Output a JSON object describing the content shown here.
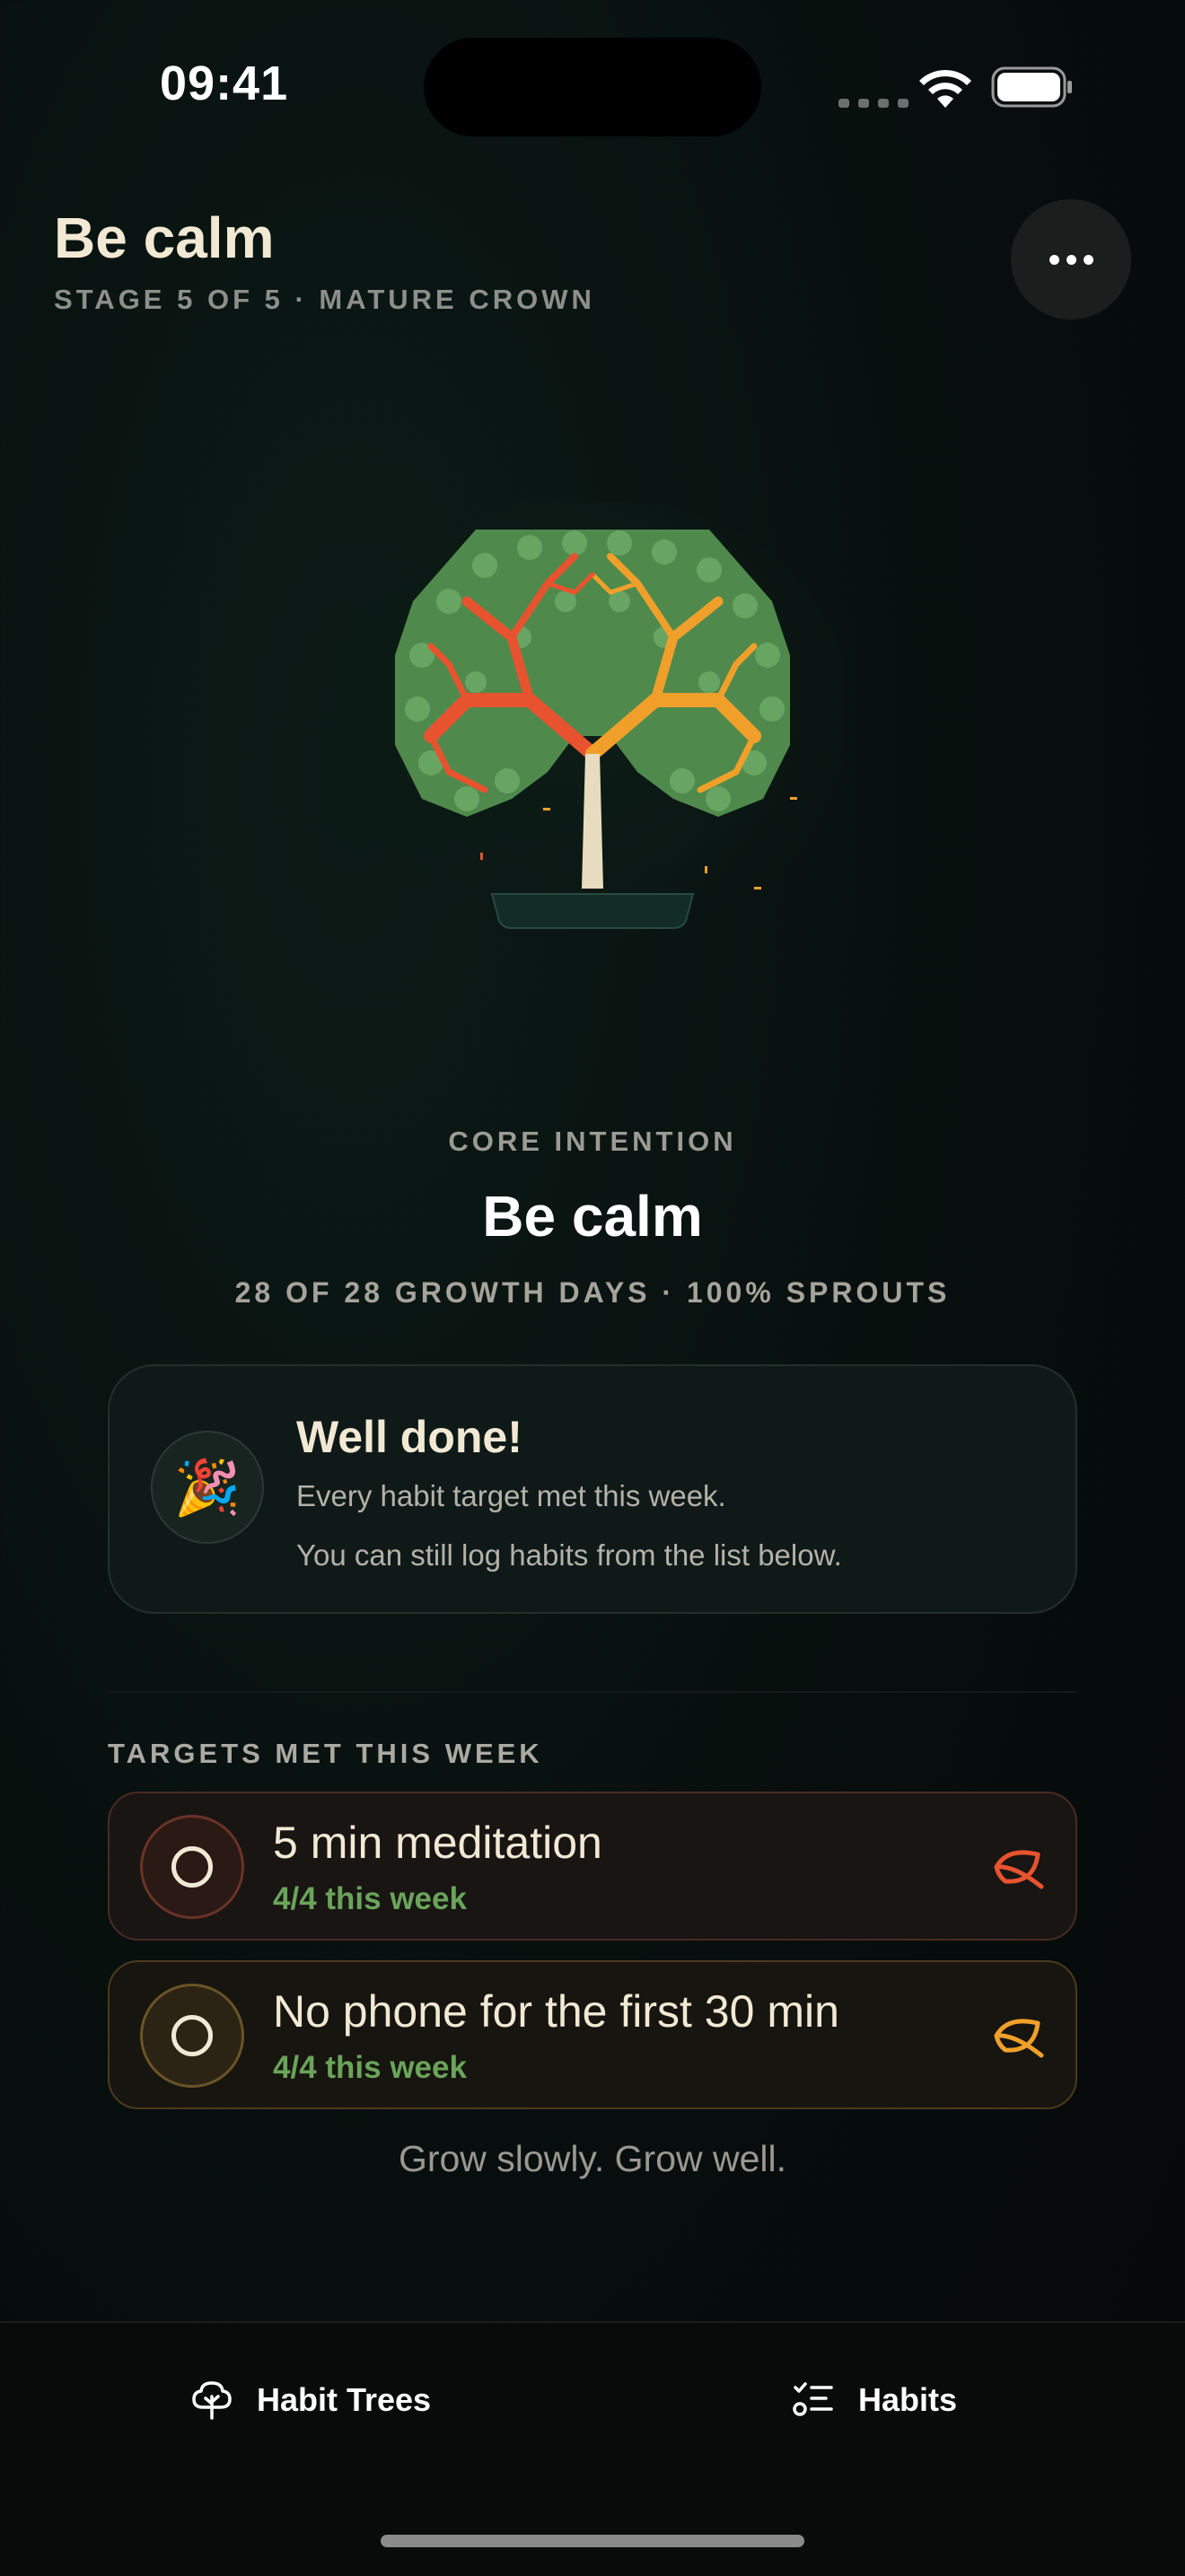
{
  "status_bar": {
    "time": "09:41"
  },
  "header": {
    "title": "Be calm",
    "subtitle": "STAGE 5 OF 5 · MATURE CROWN"
  },
  "core": {
    "label": "CORE INTENTION",
    "title": "Be calm",
    "stats": "28 OF 28 GROWTH DAYS · 100% SPROUTS"
  },
  "congrats": {
    "emoji": "🎉",
    "title": "Well done!",
    "line1": "Every habit target met this week.",
    "line2": "You can still log habits from the list below."
  },
  "section_label": "TARGETS MET THIS WEEK",
  "habits": [
    {
      "name": "5 min meditation",
      "count": "4/4 this week",
      "accent": "#e8532f"
    },
    {
      "name": "No phone for the first 30 min",
      "count": "4/4 this week",
      "accent": "#f0a02a"
    }
  ],
  "tagline": "Grow slowly. Grow well.",
  "tabbar": {
    "tab1_label": "Habit Trees",
    "tab2_label": "Habits"
  },
  "colors": {
    "accent_red": "#e8532f",
    "accent_orange": "#f0a02a",
    "leaf_green": "#5e9a5a",
    "success_text": "#6aa45a"
  }
}
